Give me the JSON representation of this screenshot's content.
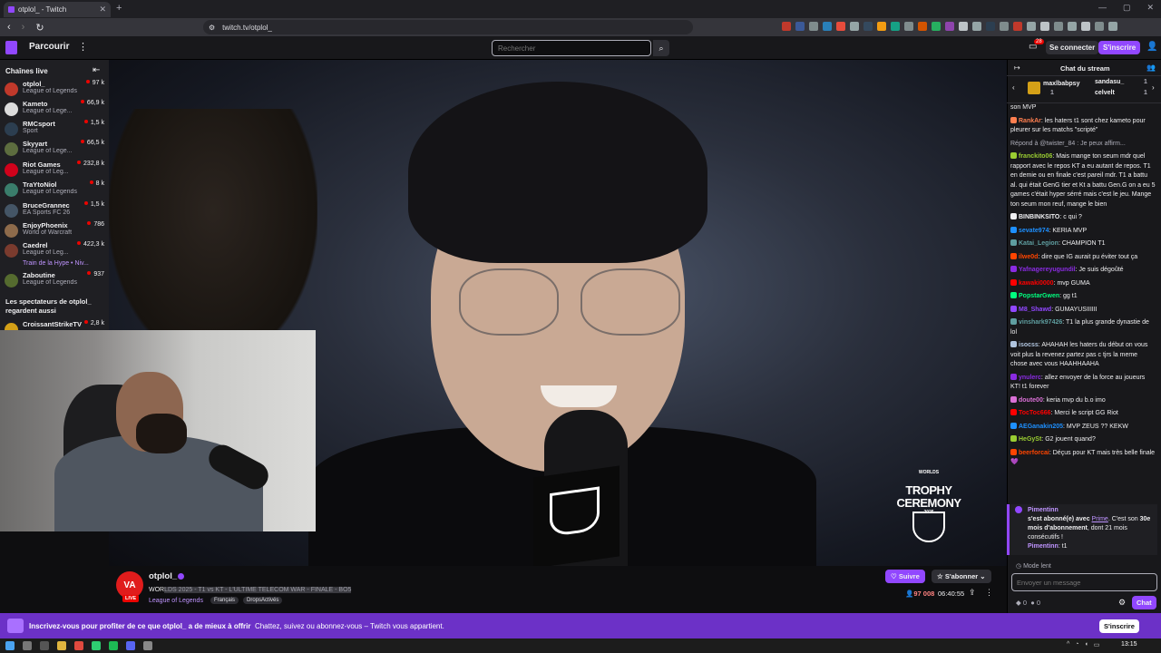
{
  "browser": {
    "tab_title": "otplol_ - Twitch",
    "new_tab": "+",
    "url": "twitch.tv/otplol_"
  },
  "nav": {
    "browse": "Parcourir",
    "search_placeholder": "Rechercher",
    "notif_count": "28",
    "login": "Se connecter",
    "signup": "S'inscrire"
  },
  "sidebar": {
    "heading": "Chaînes live",
    "channels": [
      {
        "name": "otplol_",
        "game": "League of Legends",
        "viewers": "97 k",
        "color": "#c0392b"
      },
      {
        "name": "Kameto",
        "game": "League of Lege...",
        "viewers": "66,9 k",
        "color": "#dcdcdc"
      },
      {
        "name": "RMCsport",
        "game": "Sport",
        "viewers": "1,5 k",
        "color": "#2c3e50"
      },
      {
        "name": "Skyyart",
        "game": "League of Lege...",
        "viewers": "66,5 k",
        "color": "#5d6d3f"
      },
      {
        "name": "Riot Games",
        "game": "League of Leg...",
        "viewers": "232,8 k",
        "color": "#d0021b"
      },
      {
        "name": "TraYtoNiol",
        "game": "League of Legends",
        "viewers": "8 k",
        "color": "#3a7d6b"
      },
      {
        "name": "BruceGrannec",
        "game": "EA Sports FC 26",
        "viewers": "1,5 k",
        "color": "#445566"
      },
      {
        "name": "EnjoyPhoenix",
        "game": "World of Warcraft",
        "viewers": "786",
        "color": "#8e6b4b"
      },
      {
        "name": "Caedrel",
        "game": "League of Leg...",
        "viewers": "422,3 k",
        "color": "#7a3b2e"
      },
      {
        "name": "Zaboutine",
        "game": "League of Legends",
        "viewers": "937",
        "color": "#556b2f"
      }
    ],
    "hype_train": "Train de la Hype • Niv...",
    "also_watch": "Les spectateurs de otplol_ regardent aussi",
    "extra": {
      "name": "CroissantStrikeTV",
      "viewers": "2,8 k"
    }
  },
  "video": {
    "overlay_small": "WORLDS",
    "overlay_title": "TROPHY CEREMONY",
    "overlay_year": "2025"
  },
  "stream": {
    "channel": "otplol_",
    "avatar_text": "VA",
    "live": "LIVE",
    "title_start": "WOR",
    "title_selected": "LDS 2025 - T1 vs KT - L'ULTIME TELECOM WAR - FINALE - BO5",
    "game": "League of Legends",
    "tags": [
      "Français",
      "DropsActivés"
    ],
    "follow": "Suivre",
    "subscribe": "S'abonner",
    "viewers": "97 008",
    "uptime": "06:40:55"
  },
  "chat": {
    "title": "Chat du stream",
    "gifters": [
      {
        "name": "maxlbabpsy",
        "count": "1"
      },
      {
        "name": "sandasu_",
        "count": "1"
      },
      {
        "name": "celvelt",
        "count": "1"
      }
    ],
    "messages": [
      {
        "user": "",
        "color": "#efeff1",
        "text": "son MVP"
      },
      {
        "user": "RankAr",
        "color": "#ff7f50",
        "text": "les haters t1 sont chez kameto pour pleurer sur les matchs \"scripté\""
      },
      {
        "user": "",
        "color": "#adadb8",
        "reply": "Répond à @twister_84 : Je peux affirm..."
      },
      {
        "user": "franckito06",
        "color": "#9acd32",
        "text": "Mais mange ton seum mdr quel rapport avec le repos KT a eu autant de repos. T1 en demie ou en finale c'est pareil mdr. T1 a battu al. qui était GenG tier et Kt a battu Gen.G on a eu 5 games c'était hyper sérré mais c'est le jeu. Mange ton seum mon reuf, mange le bien"
      },
      {
        "user": "BINBINKSITO",
        "color": "#efeff1",
        "text": "c qui ?"
      },
      {
        "user": "sevate974",
        "color": "#1e90ff",
        "text": "KERIA MVP"
      },
      {
        "user": "Katai_Legion",
        "color": "#5f9ea0",
        "text": "CHAMPION T1"
      },
      {
        "user": "ilwe0d",
        "color": "#ff4500",
        "text": "dire que IG aurait pu éviter tout ça"
      },
      {
        "user": "Yafnagereyugundil",
        "color": "#8a2be2",
        "text": "Je suis dégoûté"
      },
      {
        "user": "kawaki0000",
        "color": "#ff0000",
        "text": "mvp GUMA"
      },
      {
        "user": "PopstarGwen",
        "color": "#00ff7f",
        "text": "gg t1"
      },
      {
        "user": "M8_Shawd",
        "color": "#9147ff",
        "text": "GUMAYUSIIIIII"
      },
      {
        "user": "vinshark97426",
        "color": "#5f9ea0",
        "text": "T1 la plus grande dynastie de lol"
      },
      {
        "user": "isocss",
        "color": "#b0c4de",
        "text": "AHAHAH les haters du début on vous voit plus la revenez partez pas c tjrs la meme chose avec vous HAAHHAAHA"
      },
      {
        "user": "ynulerc",
        "color": "#8a2be2",
        "text": "allez envoyer de la force au joueurs KT! t1 forever"
      },
      {
        "user": "doute00",
        "color": "#da70d6",
        "text": "keria mvp du b.o imo"
      },
      {
        "user": "TocToc666",
        "color": "#ff0000",
        "text": "Merci le script GG Riot"
      },
      {
        "user": "AEGanakin205",
        "color": "#1e90ff",
        "text": "MVP ZEUS ?? KEKW"
      },
      {
        "user": "HeGySt",
        "color": "#9acd32",
        "text": "G2 jouent quand?"
      },
      {
        "user": "beerforcai",
        "color": "#ff4500",
        "text": "Déçus pour KT mais très belle finale 💜"
      }
    ],
    "sub_user": "Pimentinn",
    "sub_text_1": "s'est abonné(e) avec",
    "sub_prime": "Prime",
    "sub_text_2": ". C'est son",
    "sub_months": "30e mois d'abonnement",
    "sub_text_3": ", dont 21 mois consécutifs !",
    "sub_reply_user": "Pimentinn",
    "sub_reply_text": "t1",
    "slow_mode": "Mode lent",
    "input_placeholder": "Envoyer un message",
    "points_a": "0",
    "points_b": "0",
    "send": "Chat"
  },
  "banner": {
    "bold": "Inscrivez-vous pour profiter de ce que otplol_ a de mieux à offrir",
    "rest": "Chattez, suivez ou abonnez-vous – Twitch vous appartient.",
    "button": "S'inscrire"
  },
  "taskbar": {
    "time": "13:15"
  }
}
